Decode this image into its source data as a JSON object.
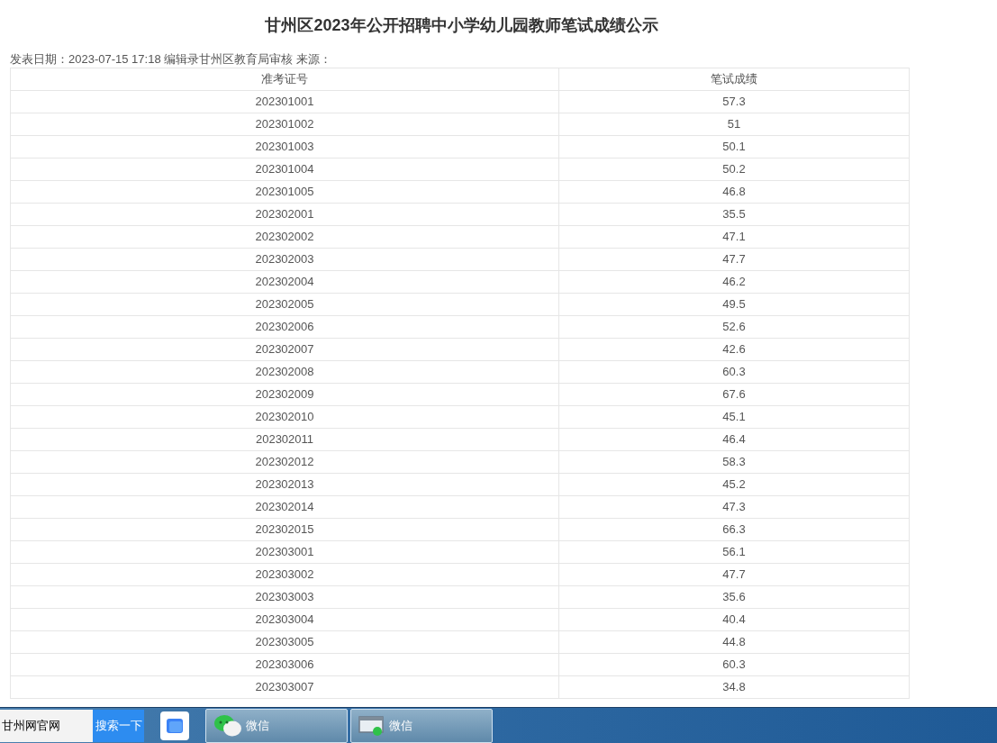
{
  "article": {
    "title": "甘州区2023年公开招聘中小学幼儿园教师笔试成绩公示",
    "meta": "发表日期：2023-07-15 17:18 编辑录甘州区教育局审核 来源："
  },
  "table": {
    "columns": [
      "准考证号",
      "笔试成绩"
    ],
    "rows": [
      [
        "202301001",
        "57.3"
      ],
      [
        "202301002",
        "51"
      ],
      [
        "202301003",
        "50.1"
      ],
      [
        "202301004",
        "50.2"
      ],
      [
        "202301005",
        "46.8"
      ],
      [
        "202302001",
        "35.5"
      ],
      [
        "202302002",
        "47.1"
      ],
      [
        "202302003",
        "47.7"
      ],
      [
        "202302004",
        "46.2"
      ],
      [
        "202302005",
        "49.5"
      ],
      [
        "202302006",
        "52.6"
      ],
      [
        "202302007",
        "42.6"
      ],
      [
        "202302008",
        "60.3"
      ],
      [
        "202302009",
        "67.6"
      ],
      [
        "202302010",
        "45.1"
      ],
      [
        "202302011",
        "46.4"
      ],
      [
        "202302012",
        "58.3"
      ],
      [
        "202302013",
        "45.2"
      ],
      [
        "202302014",
        "47.3"
      ],
      [
        "202302015",
        "66.3"
      ],
      [
        "202303001",
        "56.1"
      ],
      [
        "202303002",
        "47.7"
      ],
      [
        "202303003",
        "35.6"
      ],
      [
        "202303004",
        "40.4"
      ],
      [
        "202303005",
        "44.8"
      ],
      [
        "202303006",
        "60.3"
      ],
      [
        "202303007",
        "34.8"
      ]
    ]
  },
  "taskbar": {
    "search": {
      "value": "甘州网官网",
      "button": "搜索一下"
    },
    "tasks": [
      {
        "label": "微信",
        "kind": "chat"
      },
      {
        "label": "微信",
        "kind": "window"
      }
    ]
  }
}
